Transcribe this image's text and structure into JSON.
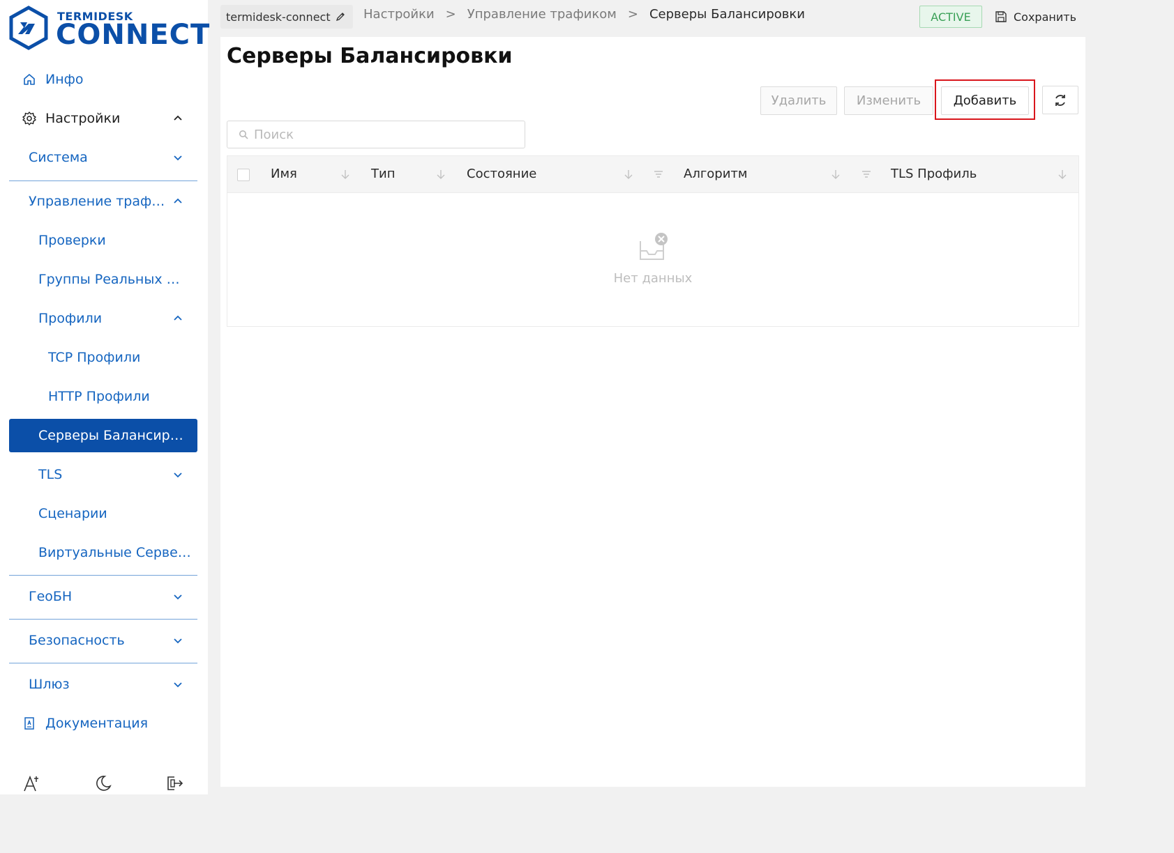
{
  "app": {
    "logo_small": "TERMIDESK",
    "logo_big": "CONNECT",
    "brand_color": "#0b4fa8"
  },
  "sidebar": {
    "items": [
      {
        "label": "Инфо",
        "icon": "home-icon"
      },
      {
        "label": "Настройки",
        "icon": "gear-icon",
        "expanded": true
      },
      {
        "label": "Система",
        "expanded": false
      },
      {
        "label": "Управление трафиком",
        "expanded": true
      },
      {
        "label": "Проверки"
      },
      {
        "label": "Группы Реальных Серверов"
      },
      {
        "label": "Профили",
        "expanded": true
      },
      {
        "label": "TCP Профили"
      },
      {
        "label": "HTTP Профили"
      },
      {
        "label": "Серверы Балансировки",
        "selected": true
      },
      {
        "label": "TLS",
        "expanded": false
      },
      {
        "label": "Сценарии"
      },
      {
        "label": "Виртуальные Серверы"
      },
      {
        "label": "ГеоБН",
        "expanded": false
      },
      {
        "label": "Безопасность",
        "expanded": false
      },
      {
        "label": "Шлюз",
        "expanded": false
      },
      {
        "label": "Документация",
        "icon": "book-icon"
      }
    ],
    "bottom_icons": [
      "font-size-icon",
      "moon-icon",
      "logout-icon"
    ]
  },
  "topbar": {
    "project": "termidesk-connect",
    "breadcrumb": [
      "Настройки",
      "Управление трафиком",
      "Серверы Балансировки"
    ],
    "separator": ">",
    "status": "ACTIVE",
    "save_label": "Сохранить"
  },
  "main": {
    "title": "Серверы Балансировки",
    "buttons": {
      "delete": "Удалить",
      "edit": "Изменить",
      "add": "Добавить"
    },
    "search_placeholder": "Поиск",
    "table": {
      "columns": [
        "Имя",
        "Тип",
        "Состояние",
        "Алгоритм",
        "TLS Профиль"
      ],
      "rows": [],
      "empty_text": "Нет данных"
    }
  }
}
